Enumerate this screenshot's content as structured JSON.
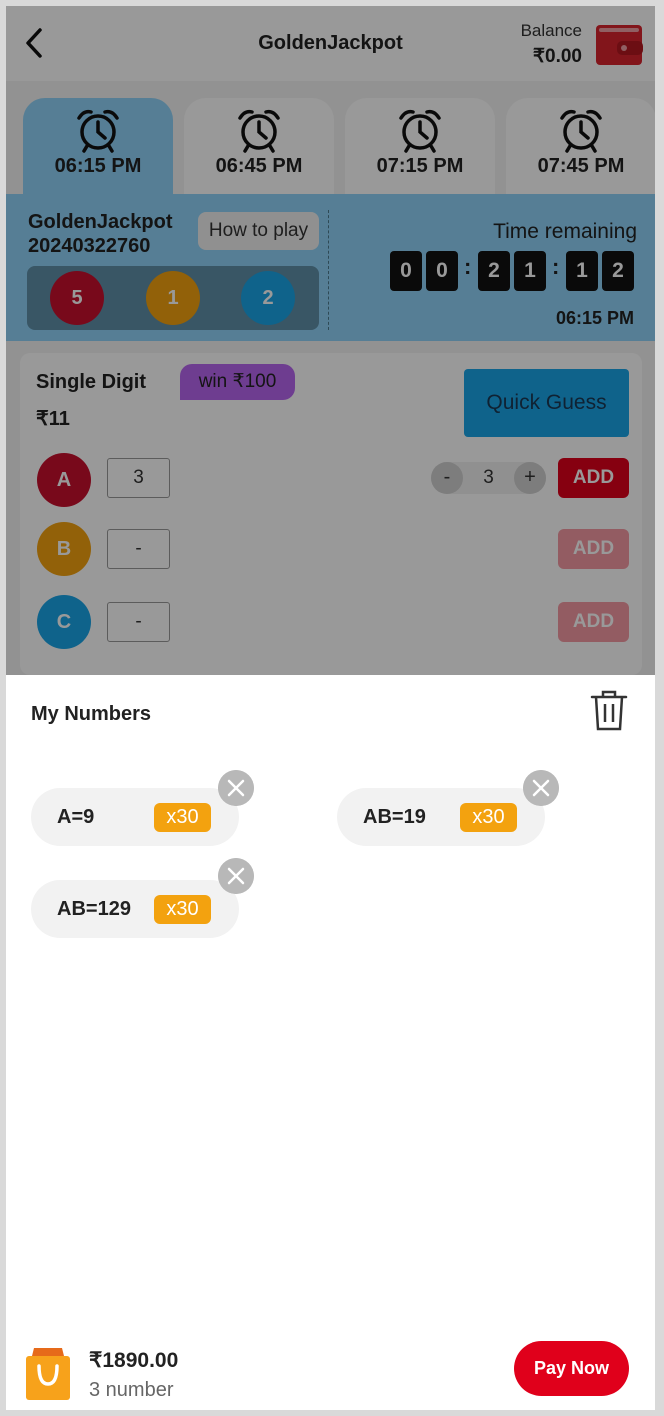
{
  "header": {
    "title": "GoldenJackpot",
    "balance_label": "Balance",
    "balance_value": "₹0.00"
  },
  "tabs": [
    {
      "time": "06:15 PM",
      "active": true
    },
    {
      "time": "06:45 PM",
      "active": false
    },
    {
      "time": "07:15 PM",
      "active": false
    },
    {
      "time": "07:45 PM",
      "active": false
    }
  ],
  "game": {
    "name": "GoldenJackpot",
    "issue": "20240322760",
    "how_to_play": "How to play",
    "results": [
      "5",
      "1",
      "2"
    ],
    "time_remaining_label": "Time remaining",
    "countdown": [
      "0",
      "0",
      "2",
      "1",
      "1",
      "2"
    ],
    "draw_time": "06:15 PM"
  },
  "bet": {
    "title": "Single Digit",
    "win_tag": "win ₹100",
    "price": "₹11",
    "quick_guess": "Quick Guess",
    "rows": [
      {
        "letter": "A",
        "value": "3",
        "add": "ADD"
      },
      {
        "letter": "B",
        "value": "-",
        "add": "ADD"
      },
      {
        "letter": "C",
        "value": "-",
        "add": "ADD"
      }
    ],
    "stepper": {
      "minus": "-",
      "value": "3",
      "plus": "+"
    }
  },
  "my_numbers": {
    "title": "My Numbers",
    "items": [
      {
        "label": "A=9",
        "badge": "x30"
      },
      {
        "label": "AB=19",
        "badge": "x30"
      },
      {
        "label": "AB=129",
        "badge": "x30"
      }
    ]
  },
  "footer": {
    "total": "₹1890.00",
    "count": "3 number",
    "pay_button": "Pay Now"
  },
  "colors": {
    "accent_red": "#e0001b",
    "active_tab": "#8fd3f8",
    "ball_red": "#c8102e",
    "ball_orange": "#f3a20f",
    "ball_blue": "#1aa5e8",
    "badge_orange": "#f3a20f"
  }
}
